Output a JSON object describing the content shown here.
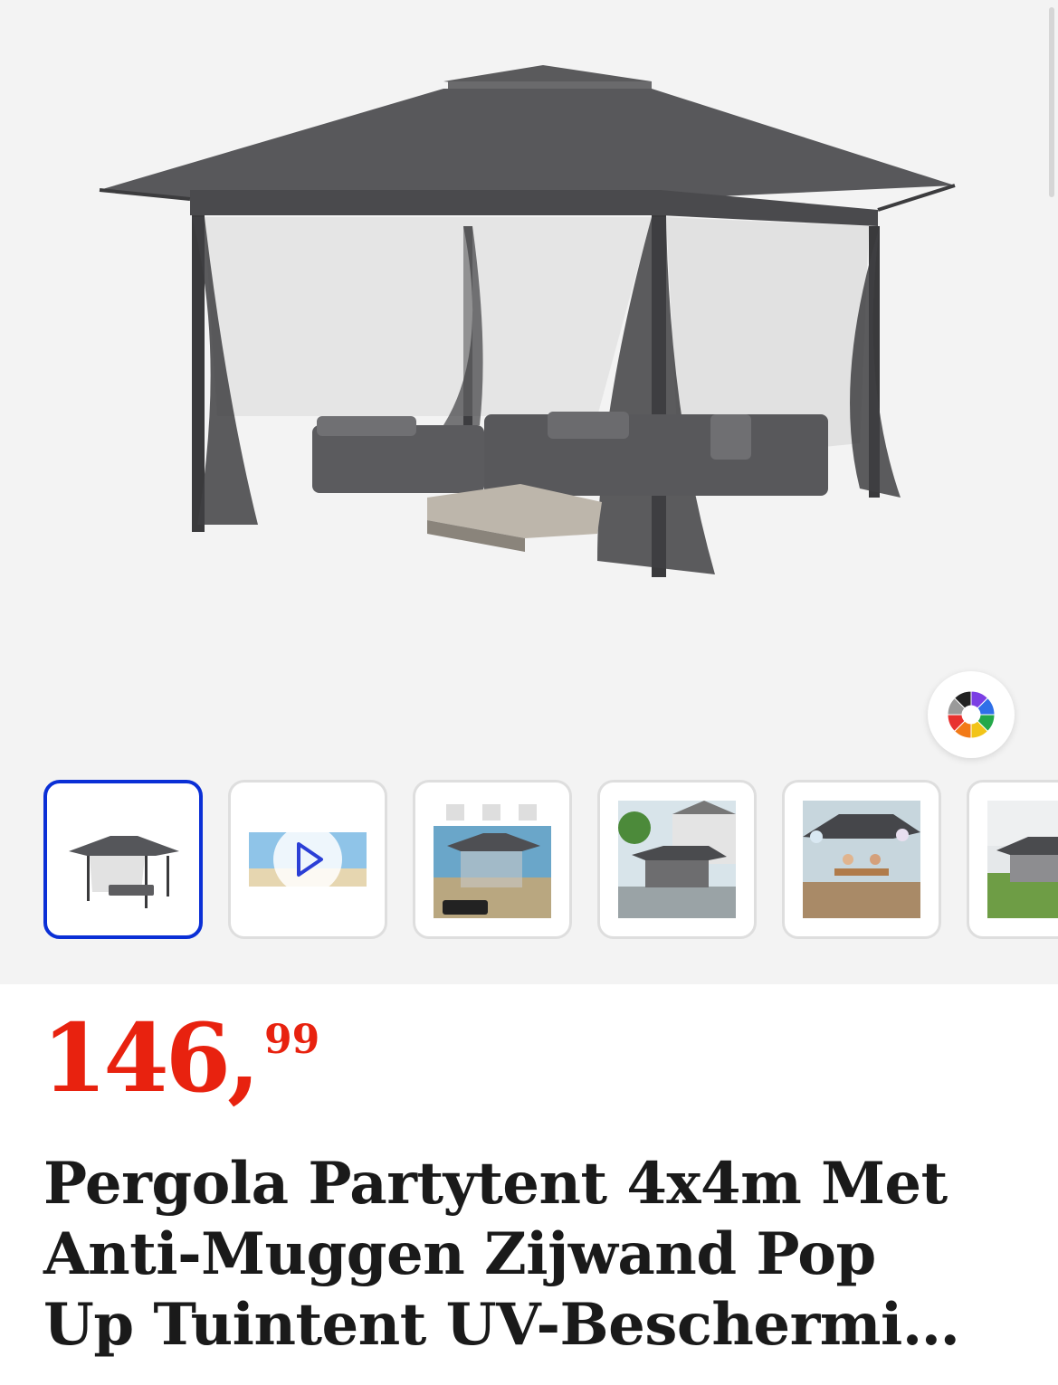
{
  "product": {
    "price_integer": "146,",
    "price_decimals": "99",
    "title_lines": [
      "Pergola Partytent 4x4m Met",
      "Anti-Muggen Zijwand Pop",
      "Up Tuintent UV-Beschermi…"
    ],
    "price_color": "#e8220f"
  },
  "gallery": {
    "active_index": 0,
    "thumbnails": [
      {
        "type": "image",
        "icon": "gazebo-thumbnail"
      },
      {
        "type": "video",
        "icon": "play-icon"
      },
      {
        "type": "image",
        "icon": "gazebo-features-thumbnail"
      },
      {
        "type": "image",
        "icon": "gazebo-garden-thumbnail"
      },
      {
        "type": "image",
        "icon": "gazebo-dining-thumbnail"
      },
      {
        "type": "image",
        "icon": "gazebo-lawn-thumbnail"
      }
    ],
    "color_picker_icon": "color-wheel-icon",
    "active_border_color": "#0a2fd6"
  }
}
